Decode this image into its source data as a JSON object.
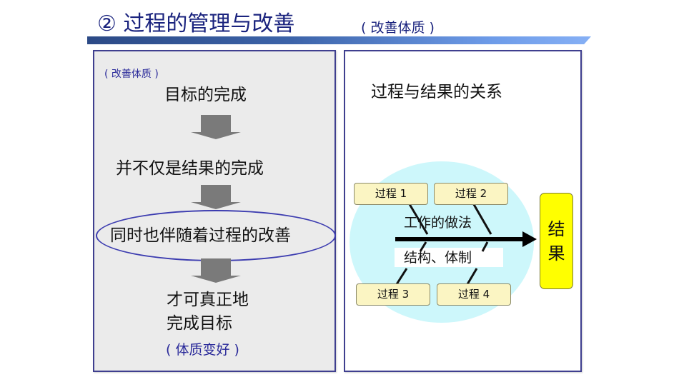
{
  "header": {
    "title": "② 过程的管理与改善",
    "subtitle": "( 改善体质 )"
  },
  "left_panel": {
    "note_top": "( 改善体质 )",
    "steps": [
      "目标的完成",
      "并不仅是结果的完成",
      "同时也伴随着过程的改善",
      "才可真正地",
      "完成目标"
    ],
    "note_bottom": "( 体质变好 )",
    "highlighted_step_index": 2
  },
  "right_panel": {
    "title": "过程与结果的关系",
    "processes": [
      "过程 1",
      "过程 2",
      "过程 3",
      "过程 4"
    ],
    "upper_label": "工作的做法",
    "lower_label": "结构、体制",
    "result_chars": [
      "结",
      "果"
    ]
  },
  "colors": {
    "title_text": "#1a237e",
    "accent_blue": "#2a2a9a",
    "panel_border": "#3f3f8f",
    "left_panel_bg": "#ebebeb",
    "arrow_gray": "#7a7a7a",
    "process_box_fill": "#fbf5c3",
    "result_fill": "#ffff00",
    "circle_fill": "#cdf7fb"
  }
}
